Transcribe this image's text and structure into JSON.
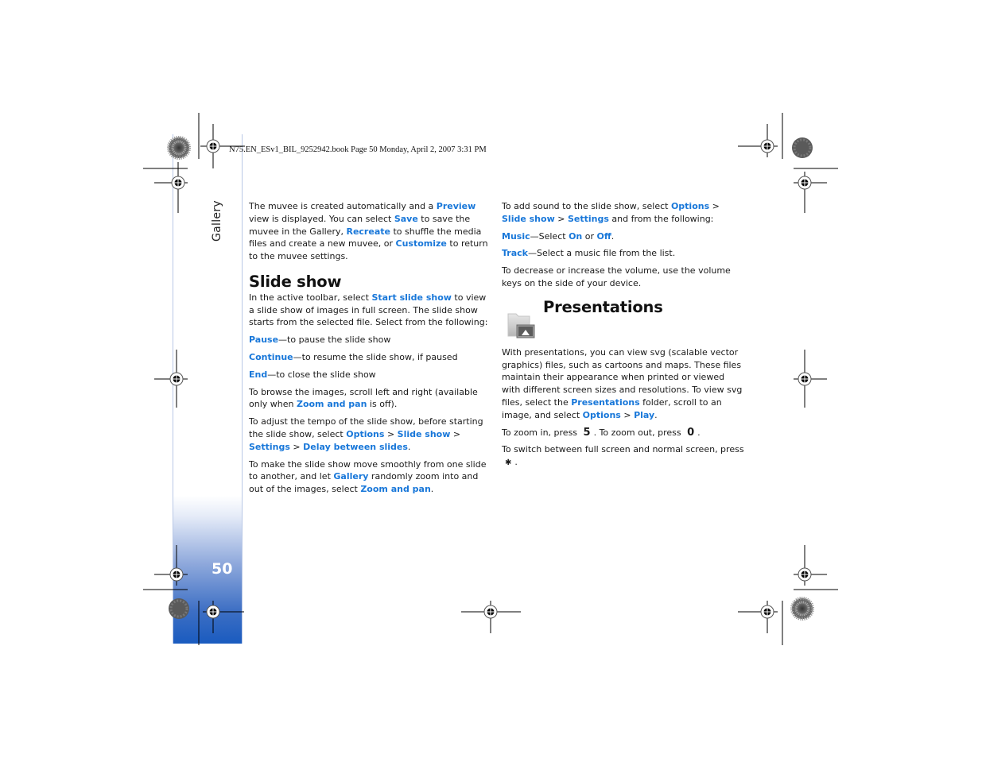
{
  "header": {
    "print_slug": "N75.EN_ESv1_BIL_9252942.book  Page 50  Monday, April 2, 2007  3:31 PM"
  },
  "sidebar": {
    "section_label": "Gallery",
    "page_number": "50",
    "colors": {
      "gradient_top": "#ffffff",
      "gradient_bottom": "#1a5bbf"
    }
  },
  "left_column": {
    "intro": {
      "t1": "The muvee is created automatically and a ",
      "preview": "Preview",
      "t2": " view is displayed. You can select ",
      "save": "Save",
      "t3": " to save the muvee in the Gallery, ",
      "recreate": "Recreate",
      "t4": "  to shuffle the media files and create a new muvee, or ",
      "customize": "Customize",
      "t5": " to return to the muvee settings."
    },
    "slide_show": {
      "heading": "Slide show",
      "p1_t1": "In the active toolbar, select ",
      "p1_link": "Start slide show",
      "p1_t2": " to view a slide show of images in full screen. The slide show starts from the selected file. Select from the following:",
      "options": [
        {
          "label": "Pause",
          "desc": "—to pause the slide show"
        },
        {
          "label": "Continue",
          "desc": "—to resume the slide show, if paused"
        },
        {
          "label": "End",
          "desc": "—to close the slide show"
        }
      ],
      "browse_t1": "To browse the images, scroll left and right (available only when ",
      "browse_link": "Zoom and pan",
      "browse_t2": " is off).",
      "tempo_t1": "To adjust the tempo of the slide show, before starting the slide show, select ",
      "tempo_path": [
        "Options",
        "Slide show",
        "Settings",
        "Delay between slides"
      ],
      "tempo_sep": " > ",
      "tempo_end": ".",
      "smooth_t1": "To make the slide show move smoothly from one slide to another, and let ",
      "smooth_link1": "Gallery",
      "smooth_t2": " randomly zoom into and out of the images, select ",
      "smooth_link2": "Zoom and pan",
      "smooth_t3": "."
    }
  },
  "right_column": {
    "sound_t1": "To add sound to the slide show, select ",
    "sound_options": "Options",
    "sound_sep1": " > ",
    "sound_slideshow": "Slide show",
    "sound_sep2": " > ",
    "sound_settings": "Settings",
    "sound_t2": " and from the following:",
    "music_label": "Music",
    "music_t1": "—Select ",
    "music_on": "On",
    "music_or": " or ",
    "music_off": "Off",
    "music_end": ".",
    "track_label": "Track",
    "track_desc": "—Select a music file from the list.",
    "volume_text": "To decrease or increase the volume, use the volume keys on the side of your device.",
    "presentations": {
      "heading": "Presentations",
      "icon": "presentations-folder-icon",
      "p1_t1": "With presentations, you can view svg (scalable vector graphics) files, such as cartoons and maps. These files maintain their appearance when printed or viewed with different screen sizes and resolutions. To view svg files, select the ",
      "p1_link": "Presentations",
      "p1_t2": " folder, scroll to an image, and select ",
      "p1_options": "Options",
      "p1_sep": " > ",
      "p1_play": "Play",
      "p1_end": ".",
      "zoom_t1": "To zoom in, press ",
      "zoom_in_key": "5",
      "zoom_t2": ". To zoom out, press ",
      "zoom_out_key": "0",
      "zoom_t3": ".",
      "switch_t1": "To switch between full screen and normal screen, press ",
      "switch_key": "✱",
      "switch_t2": "."
    }
  },
  "colors": {
    "link": "#1877d9",
    "text": "#1a1a1a"
  }
}
